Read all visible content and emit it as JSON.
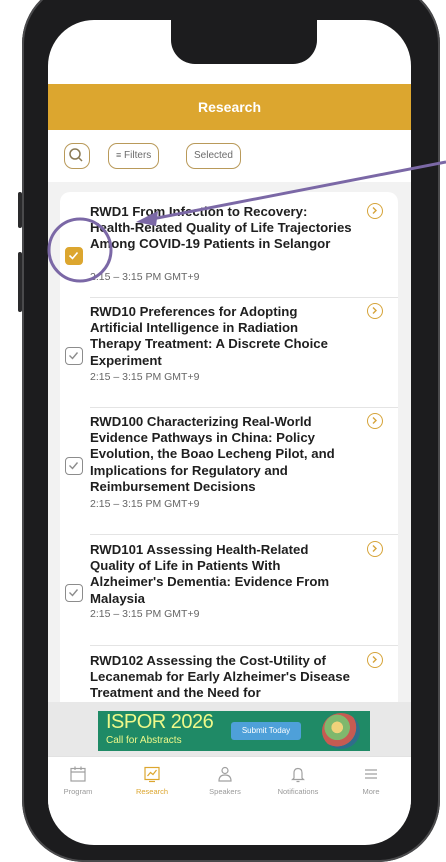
{
  "header": {
    "title": "Research"
  },
  "filters": {
    "search_icon": "search-icon",
    "filters_label": "Filters",
    "selected_label": "Selected"
  },
  "sessions": [
    {
      "title": "RWD1 From Infection to Recovery: Health-Related Quality of Life Trajectories Among COVID-19 Patients in Selangor",
      "time": "2:15 – 3:15 PM GMT+9",
      "selected": true
    },
    {
      "title": "RWD10 Preferences for Adopting Artificial Intelligence in Radiation Therapy Treatment: A Discrete Choice Experiment",
      "time": "2:15 – 3:15 PM GMT+9",
      "selected": false
    },
    {
      "title": "RWD100 Characterizing Real-World Evidence Pathways in China: Policy Evolution, the Boao Lecheng Pilot, and Implications for Regulatory and Reimbursement Decisions",
      "time": "2:15 – 3:15 PM GMT+9",
      "selected": false
    },
    {
      "title": "RWD101 Assessing Health-Related Quality of Life in Patients With Alzheimer's Dementia: Evidence From Malaysia",
      "time": "2:15 – 3:15 PM GMT+9",
      "selected": false
    },
    {
      "title": "RWD102 Assessing the Cost-Utility of Lecanemab for Early Alzheimer's Disease Treatment and the Need for",
      "time": "",
      "selected": false
    }
  ],
  "banner": {
    "brand": "ISPOR 2026",
    "subtitle": "Call for Abstracts",
    "cta": "Submit Today"
  },
  "tabs": [
    {
      "label": "Program",
      "icon": "calendar-icon",
      "active": false
    },
    {
      "label": "Research",
      "icon": "chart-icon",
      "active": true
    },
    {
      "label": "Speakers",
      "icon": "person-icon",
      "active": false
    },
    {
      "label": "Notifications",
      "icon": "bell-icon",
      "active": false
    },
    {
      "label": "More",
      "icon": "menu-icon",
      "active": false
    }
  ],
  "colors": {
    "accent": "#dca62f",
    "annotation": "#7b68a6",
    "banner_bg": "#1f8a66"
  }
}
